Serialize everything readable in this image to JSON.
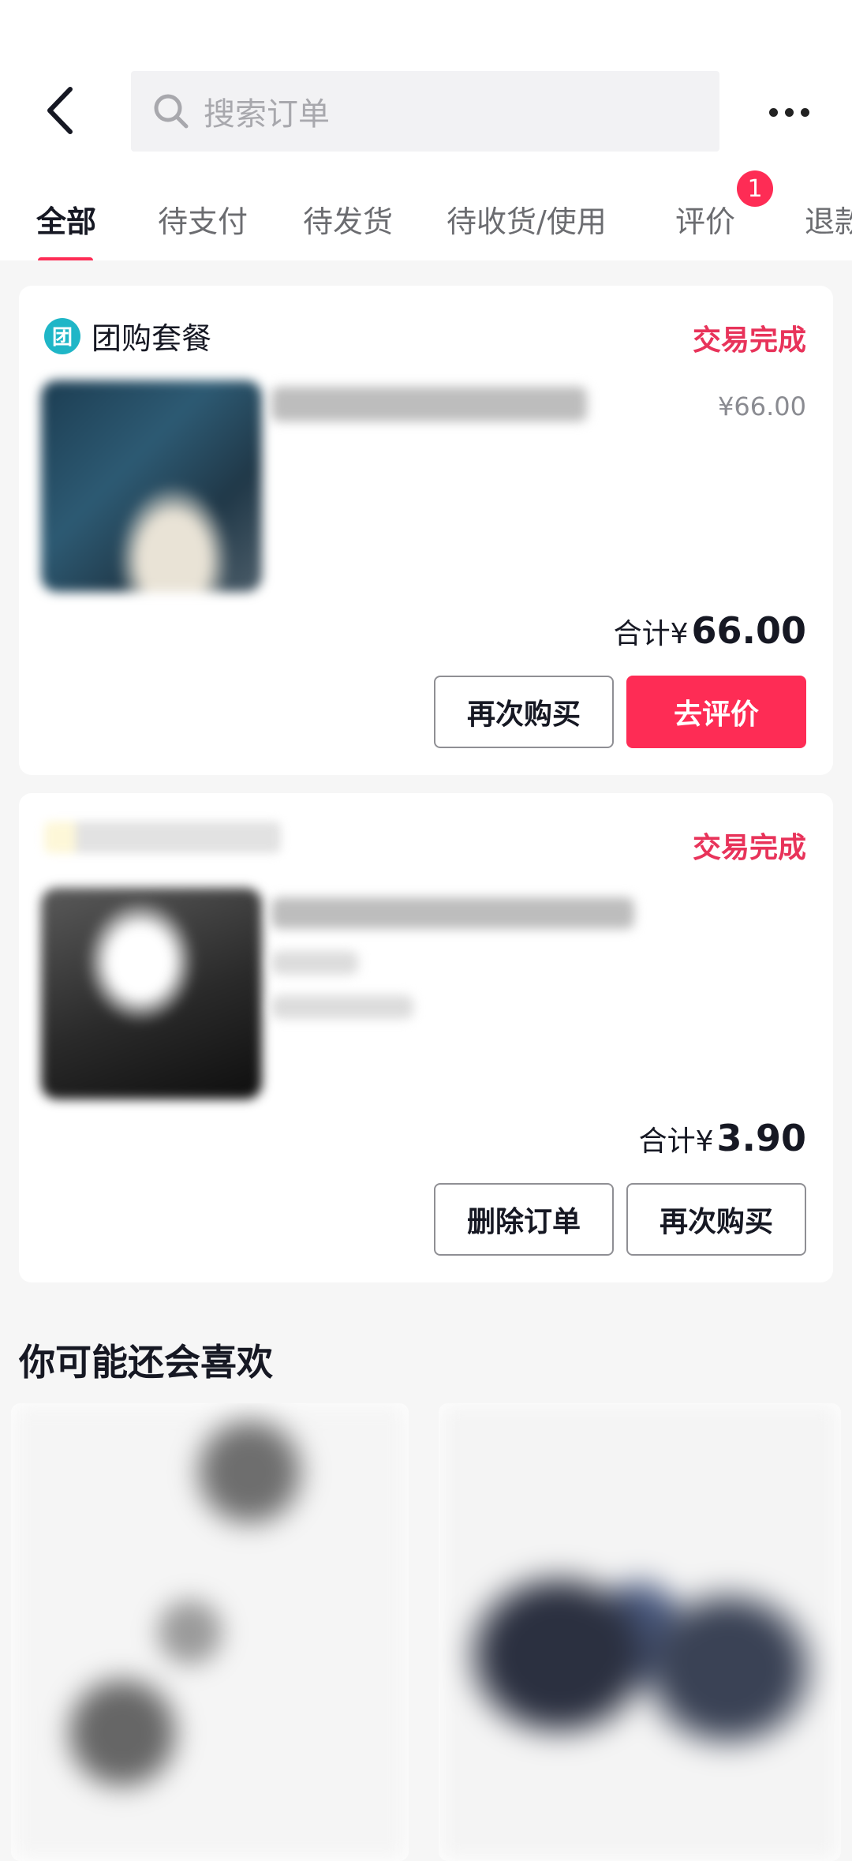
{
  "header": {
    "search_placeholder": "搜索订单"
  },
  "tabs": [
    {
      "label": "全部",
      "active": true
    },
    {
      "label": "待支付"
    },
    {
      "label": "待发货"
    },
    {
      "label": "待收货/使用"
    },
    {
      "label": "评价",
      "badge": "1"
    },
    {
      "label": "退款"
    }
  ],
  "orders": [
    {
      "shop_icon": "团",
      "shop_name": "团购套餐",
      "status": "交易完成",
      "unit_price": "¥66.00",
      "total_label": "合计¥",
      "total_value": "66.00",
      "buttons": [
        "再次购买",
        "去评价"
      ]
    },
    {
      "status": "交易完成",
      "total_label": "合计¥",
      "total_value": "3.90",
      "buttons": [
        "删除订单",
        "再次购买"
      ]
    }
  ],
  "recommend": {
    "title": "你可能还会喜欢"
  },
  "colors": {
    "accent": "#fe2c55",
    "status": "#e8335a",
    "groupbuy_icon": "#1fb6c7"
  },
  "icons": [
    "back-arrow-icon",
    "search-icon",
    "more-dots-icon"
  ]
}
